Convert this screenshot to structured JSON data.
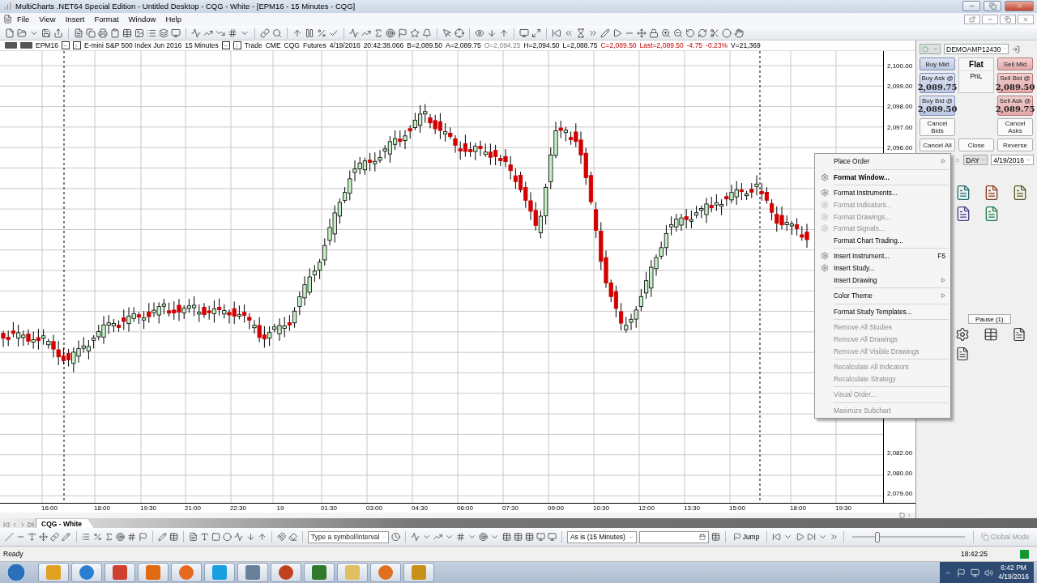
{
  "window": {
    "title": "MultiCharts .NET64 Special Edition - Untitled Desktop - CQG - White - [EPM16 - 15 Minutes - CQG]"
  },
  "menu_bar": [
    "File",
    "View",
    "Insert",
    "Format",
    "Window",
    "Help"
  ],
  "chart_header": {
    "symbol": "EPM16",
    "description": "E-mini S&P 500 Index Jun 2016",
    "interval": "15 Minutes",
    "quote": [
      {
        "text": "Trade",
        "kind": "plain"
      },
      {
        "text": "CME",
        "kind": "plain"
      },
      {
        "text": "CQG",
        "kind": "plain"
      },
      {
        "text": "Futures",
        "kind": "plain"
      },
      {
        "text": "4/19/2016",
        "kind": "plain"
      },
      {
        "text": "20:42:38.066",
        "kind": "plain"
      },
      {
        "text": "B=2,089.50",
        "kind": "plain"
      },
      {
        "text": "A=2,089.75",
        "kind": "plain"
      },
      {
        "text": "O=2,094.25",
        "kind": "muted"
      },
      {
        "text": "H=2,094.50",
        "kind": "plain"
      },
      {
        "text": "L=2,088.75",
        "kind": "plain"
      },
      {
        "text": "C=2,089.50",
        "kind": "down"
      },
      {
        "text": "Last=2,089.50",
        "kind": "down"
      },
      {
        "text": "-4.75",
        "kind": "down"
      },
      {
        "text": "-0.23%",
        "kind": "down"
      },
      {
        "text": "V=21,369",
        "kind": "plain"
      }
    ]
  },
  "price_axis": {
    "upper": [
      "2,100.00",
      "2,099.00",
      "2,098.00",
      "2,097.00",
      "2,096.00"
    ],
    "lower": [
      "2,082.00",
      "2,080.00",
      "2,079.00"
    ]
  },
  "time_axis": [
    "16:00",
    "18:00",
    "19:30",
    "21:00",
    "22:30",
    "19",
    "01:30",
    "03:00",
    "04:30",
    "06:00",
    "07:30",
    "09:00",
    "10:30",
    "12:00",
    "13:30",
    "15:00",
    "18:00",
    "19:30"
  ],
  "order_panel": {
    "account": "DEMOAMP12430",
    "buy_market": "Buy Mkt",
    "position": "Flat",
    "pnl": "PnL",
    "sell_market": "Sell Mkt",
    "buy_ask": {
      "label": "Buy Ask @",
      "price": "2,089.75"
    },
    "sell_bid": {
      "label": "Sell Bid @",
      "price": "2,089.50"
    },
    "buy_bid": {
      "label": "Buy Bid @",
      "price": "2,089.50"
    },
    "sell_ask": {
      "label": "Sell Ask @",
      "price": "2,089.75"
    },
    "cancel_bids": "Cancel Bids",
    "cancel_asks": "Cancel Asks",
    "cancel_all": "Cancel All",
    "close": "Close",
    "reverse": "Reverse",
    "duration": "DAY",
    "date": "4/19/2016",
    "pause": "Pause (1)"
  },
  "context_menu": [
    {
      "kind": "item",
      "label": "Place Order",
      "submenu": true,
      "disabled": false,
      "default": false
    },
    {
      "kind": "separator"
    },
    {
      "kind": "item",
      "label": "Format Window...",
      "icon": true,
      "disabled": false,
      "default": true
    },
    {
      "kind": "separator"
    },
    {
      "kind": "item",
      "label": "Format Instruments...",
      "icon": true,
      "disabled": false,
      "default": false
    },
    {
      "kind": "item",
      "label": "Format Indicators...",
      "icon": true,
      "disabled": true,
      "default": false
    },
    {
      "kind": "item",
      "label": "Format Drawings...",
      "icon": true,
      "disabled": true,
      "default": false
    },
    {
      "kind": "item",
      "label": "Format Signals...",
      "icon": true,
      "disabled": true,
      "default": false
    },
    {
      "kind": "item",
      "label": "Format Chart Trading...",
      "disabled": false,
      "default": false
    },
    {
      "kind": "separator"
    },
    {
      "kind": "item",
      "label": "Insert Instrument...",
      "icon": true,
      "shortcut": "F5",
      "disabled": false,
      "default": false
    },
    {
      "kind": "item",
      "label": "Insert Study...",
      "icon": true,
      "disabled": false,
      "default": false
    },
    {
      "kind": "item",
      "label": "Insert Drawing",
      "submenu": true,
      "disabled": false,
      "default": false
    },
    {
      "kind": "separator"
    },
    {
      "kind": "item",
      "label": "Color Theme",
      "submenu": true,
      "disabled": false,
      "default": false
    },
    {
      "kind": "separator"
    },
    {
      "kind": "item",
      "label": "Format Study Templates...",
      "disabled": false,
      "default": false
    },
    {
      "kind": "separator"
    },
    {
      "kind": "item",
      "label": "Remove All Studies",
      "disabled": true,
      "default": false
    },
    {
      "kind": "item",
      "label": "Remove All Drawings",
      "disabled": true,
      "default": false
    },
    {
      "kind": "item",
      "label": "Remove All Visible Drawings",
      "disabled": true,
      "default": false
    },
    {
      "kind": "separator"
    },
    {
      "kind": "item",
      "label": "Recalculate All Indicators",
      "disabled": true,
      "default": false
    },
    {
      "kind": "item",
      "label": "Recalculate Strategy",
      "disabled": true,
      "default": false
    },
    {
      "kind": "separator"
    },
    {
      "kind": "item",
      "label": "Visual Order...",
      "disabled": true,
      "default": false
    },
    {
      "kind": "separator"
    },
    {
      "kind": "item",
      "label": "Maximize Subchart",
      "disabled": true,
      "default": false
    }
  ],
  "sheet_tabs": [
    {
      "label": "CQG - White",
      "selected": true
    }
  ],
  "drawing_toolbar": {
    "symbol_field": {
      "placeholder": "Type a symbol/interval"
    },
    "resolution": "As is (15 Minutes)",
    "jump": "Jump",
    "zoom_slider": {
      "level": 0.2
    },
    "global_mode": {
      "label": "Global Mode",
      "disabled": true
    }
  },
  "status_bar": {
    "text": "Ready",
    "time": "18:42:25"
  },
  "taskbar": {
    "time": "6:42 PM",
    "date": "4/19/2016"
  }
}
